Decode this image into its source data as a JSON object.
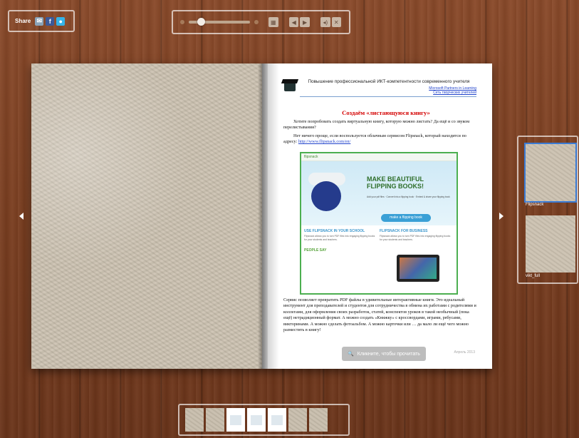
{
  "share": {
    "label": "Share",
    "icons": [
      "email-icon",
      "facebook-icon",
      "twitter-icon"
    ],
    "facebook_glyph": "f"
  },
  "controls": {
    "zoom_level": 0.15,
    "buttons": [
      "thumbnails-icon",
      "prev-page-icon",
      "next-page-icon",
      "sound-icon",
      "fullscreen-icon"
    ]
  },
  "book": {
    "header": {
      "title": "Повышение профессиональной ИКТ-компетентности современного учителя",
      "link1": "Microsoft Partners in Learning",
      "link2": "Сеть творческих учителей"
    },
    "heading": "Создаём «листающуюся книгу»",
    "para1": "Хотите попробовать создать виртуальную книгу, которую можно листать? Да ещё и со звуком перелистывания?",
    "para2_text": "Нет ничего проще, если воспользуется облачным сервисом Flipsnack, который находится по адресу:",
    "para2_link": "http://www.flipsnack.com/en/",
    "screenshot": {
      "logo": "flipsnack",
      "headline": "MAKE BEAUTIFUL FLIPPING BOOKS!",
      "bullets": "Add your pdf files · Convert into a flipping book · Embed & share your flipping book",
      "cta": "make a flipping book",
      "col1_heading": "USE FLIPSNACK IN YOUR SCHOOL",
      "col1_heading2": "PEOPLE SAY",
      "col2_heading": "FLIPSNACK FOR BUSINESS",
      "body_text": "Flipsnack allows you to turn PDF files into engaging flipping books for your students and teachers."
    },
    "para3": "Сервис позволяет превратить PDF файлы в удивительные интерактивные книги. Это идеальный инструмент для преподавателей и студентов для сотрудничества в обмена их работами с родителями и коллегами, для оформления своих разработок, статей, конспектов уроков в такой необычный (пока ещё) нетрадиционный формат. А можно создать «Книжку» с кроссвордами, играми, ребусами, викторинами. А можно сделать фотоальбом. А можно карточки или … да мало ли ещё чего можно разместить в книгу!",
    "read_button": "Кликните, чтобы прочитать",
    "date": "Апрель 2013"
  },
  "thumbs": [
    {
      "label": "Flipsnack",
      "selected": true
    },
    {
      "label": "vikt_full",
      "selected": false
    }
  ],
  "strip": {
    "count": 8
  },
  "colors": {
    "accent": "#3a7bd5",
    "heading": "#d40000",
    "wood": "#7a3e20"
  }
}
